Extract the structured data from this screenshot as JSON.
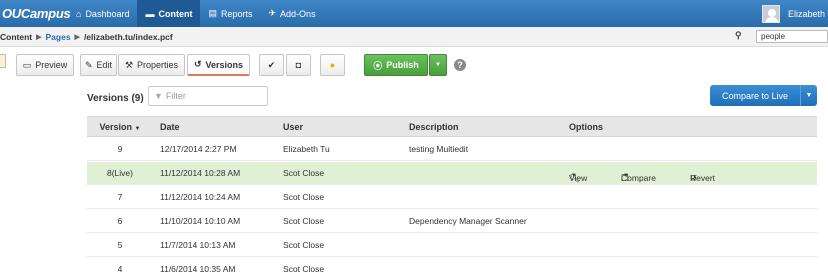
{
  "topbar": {
    "logo": "OUCampus",
    "nav": [
      {
        "label": "Dashboard",
        "icon": "home-icon"
      },
      {
        "label": "Content",
        "icon": "folder-icon",
        "active": true
      },
      {
        "label": "Reports",
        "icon": "report-icon"
      },
      {
        "label": "Add-Ons",
        "icon": "pin-icon"
      }
    ],
    "user_name": "Elizabeth Tu"
  },
  "breadcrumb": {
    "root": "Content",
    "pages": "Pages",
    "path": "/elizabeth.tu/index.pcf",
    "site_value": "people"
  },
  "toolbar": {
    "preview": "Preview",
    "edit": "Edit",
    "properties": "Properties",
    "versions": "Versions",
    "publish": "Publish"
  },
  "versions": {
    "title": "Versions (9)",
    "filter_placeholder": "Filter",
    "compare_live": "Compare to Live"
  },
  "table": {
    "headers": {
      "version": "Version",
      "date": "Date",
      "user": "User",
      "description": "Description",
      "options": "Options"
    },
    "rows": [
      {
        "version": "9",
        "date": "12/17/2014 2:27 PM",
        "user": "Elizabeth Tu",
        "description": "testing Multiedit"
      },
      {
        "version": "8(Live)",
        "date": "11/12/2014 10:28 AM",
        "user": "Scot Close",
        "description": ""
      },
      {
        "version": "7",
        "date": "11/12/2014 10:24 AM",
        "user": "Scot Close",
        "description": ""
      },
      {
        "version": "6",
        "date": "11/10/2014 10:10 AM",
        "user": "Scot Close",
        "description": "Dependency Manager Scanner"
      },
      {
        "version": "5",
        "date": "11/7/2014 10:13 AM",
        "user": "Scot Close",
        "description": ""
      },
      {
        "version": "4",
        "date": "11/6/2014 10:35 AM",
        "user": "Scot Close",
        "description": ""
      }
    ],
    "options": {
      "view": "View",
      "compare": "Compare",
      "revert": "Revert"
    }
  },
  "colors": {
    "nav_blue": "#2a6bab",
    "live_row": "#dff0d4",
    "publish_green": "#4a9e3e",
    "compare_blue": "#1f6fb8"
  }
}
